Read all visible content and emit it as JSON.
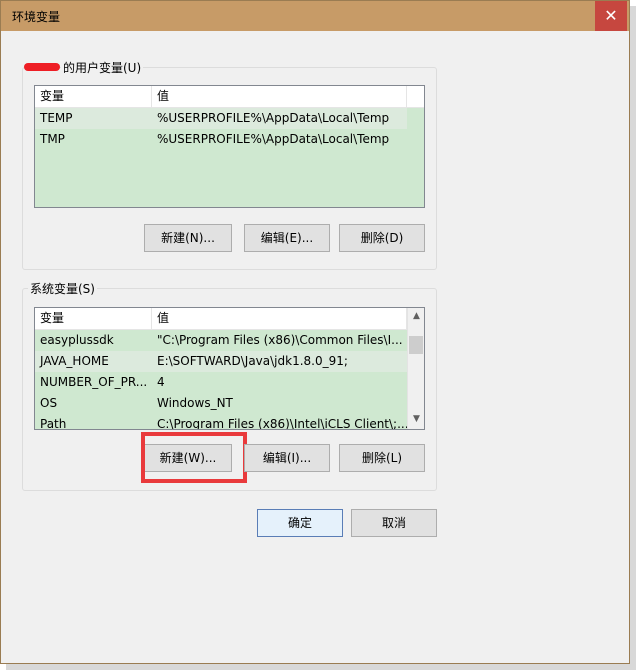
{
  "window": {
    "title": "环境变量",
    "close_glyph": "✕"
  },
  "user_vars": {
    "group_label": "的用户变量(U)",
    "columns": [
      "变量",
      "值"
    ],
    "rows": [
      {
        "name": "TEMP",
        "value": "%USERPROFILE%\\AppData\\Local\\Temp"
      },
      {
        "name": "TMP",
        "value": "%USERPROFILE%\\AppData\\Local\\Temp"
      }
    ],
    "buttons": {
      "new": "新建(N)...",
      "edit": "编辑(E)...",
      "delete": "删除(D)"
    }
  },
  "system_vars": {
    "group_label": "系统变量(S)",
    "columns": [
      "变量",
      "值"
    ],
    "rows": [
      {
        "name": "easyplussdk",
        "value": "\"C:\\Program Files (x86)\\Common Files\\I..."
      },
      {
        "name": "JAVA_HOME",
        "value": "E:\\SOFTWARD\\Java\\jdk1.8.0_91;"
      },
      {
        "name": "NUMBER_OF_PR...",
        "value": "4"
      },
      {
        "name": "OS",
        "value": "Windows_NT"
      },
      {
        "name": "Path",
        "value": "C:\\Program Files (x86)\\Intel\\iCLS Client\\;..."
      }
    ],
    "buttons": {
      "new": "新建(W)...",
      "edit": "编辑(I)...",
      "delete": "删除(L)"
    }
  },
  "footer": {
    "ok": "确定",
    "cancel": "取消"
  },
  "colors": {
    "titlebar": "#c79b67",
    "close": "#c6473f",
    "row_bg": "#cfe8d0",
    "highlight": "#e93a3c"
  },
  "icons": {
    "scroll_up": "▲",
    "scroll_down": "▼"
  }
}
